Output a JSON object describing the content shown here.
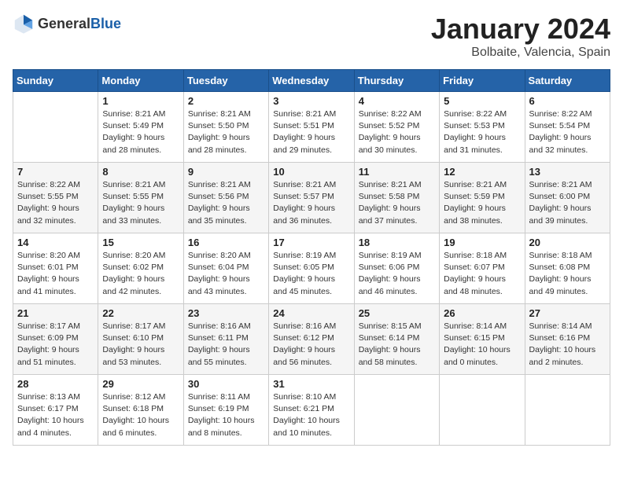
{
  "header": {
    "logo_general": "General",
    "logo_blue": "Blue",
    "title": "January 2024",
    "location": "Bolbaite, Valencia, Spain"
  },
  "weekdays": [
    "Sunday",
    "Monday",
    "Tuesday",
    "Wednesday",
    "Thursday",
    "Friday",
    "Saturday"
  ],
  "weeks": [
    [
      {
        "day": "",
        "info": ""
      },
      {
        "day": "1",
        "info": "Sunrise: 8:21 AM\nSunset: 5:49 PM\nDaylight: 9 hours\nand 28 minutes."
      },
      {
        "day": "2",
        "info": "Sunrise: 8:21 AM\nSunset: 5:50 PM\nDaylight: 9 hours\nand 28 minutes."
      },
      {
        "day": "3",
        "info": "Sunrise: 8:21 AM\nSunset: 5:51 PM\nDaylight: 9 hours\nand 29 minutes."
      },
      {
        "day": "4",
        "info": "Sunrise: 8:22 AM\nSunset: 5:52 PM\nDaylight: 9 hours\nand 30 minutes."
      },
      {
        "day": "5",
        "info": "Sunrise: 8:22 AM\nSunset: 5:53 PM\nDaylight: 9 hours\nand 31 minutes."
      },
      {
        "day": "6",
        "info": "Sunrise: 8:22 AM\nSunset: 5:54 PM\nDaylight: 9 hours\nand 32 minutes."
      }
    ],
    [
      {
        "day": "7",
        "info": "Sunrise: 8:22 AM\nSunset: 5:55 PM\nDaylight: 9 hours\nand 32 minutes."
      },
      {
        "day": "8",
        "info": "Sunrise: 8:21 AM\nSunset: 5:55 PM\nDaylight: 9 hours\nand 33 minutes."
      },
      {
        "day": "9",
        "info": "Sunrise: 8:21 AM\nSunset: 5:56 PM\nDaylight: 9 hours\nand 35 minutes."
      },
      {
        "day": "10",
        "info": "Sunrise: 8:21 AM\nSunset: 5:57 PM\nDaylight: 9 hours\nand 36 minutes."
      },
      {
        "day": "11",
        "info": "Sunrise: 8:21 AM\nSunset: 5:58 PM\nDaylight: 9 hours\nand 37 minutes."
      },
      {
        "day": "12",
        "info": "Sunrise: 8:21 AM\nSunset: 5:59 PM\nDaylight: 9 hours\nand 38 minutes."
      },
      {
        "day": "13",
        "info": "Sunrise: 8:21 AM\nSunset: 6:00 PM\nDaylight: 9 hours\nand 39 minutes."
      }
    ],
    [
      {
        "day": "14",
        "info": "Sunrise: 8:20 AM\nSunset: 6:01 PM\nDaylight: 9 hours\nand 41 minutes."
      },
      {
        "day": "15",
        "info": "Sunrise: 8:20 AM\nSunset: 6:02 PM\nDaylight: 9 hours\nand 42 minutes."
      },
      {
        "day": "16",
        "info": "Sunrise: 8:20 AM\nSunset: 6:04 PM\nDaylight: 9 hours\nand 43 minutes."
      },
      {
        "day": "17",
        "info": "Sunrise: 8:19 AM\nSunset: 6:05 PM\nDaylight: 9 hours\nand 45 minutes."
      },
      {
        "day": "18",
        "info": "Sunrise: 8:19 AM\nSunset: 6:06 PM\nDaylight: 9 hours\nand 46 minutes."
      },
      {
        "day": "19",
        "info": "Sunrise: 8:18 AM\nSunset: 6:07 PM\nDaylight: 9 hours\nand 48 minutes."
      },
      {
        "day": "20",
        "info": "Sunrise: 8:18 AM\nSunset: 6:08 PM\nDaylight: 9 hours\nand 49 minutes."
      }
    ],
    [
      {
        "day": "21",
        "info": "Sunrise: 8:17 AM\nSunset: 6:09 PM\nDaylight: 9 hours\nand 51 minutes."
      },
      {
        "day": "22",
        "info": "Sunrise: 8:17 AM\nSunset: 6:10 PM\nDaylight: 9 hours\nand 53 minutes."
      },
      {
        "day": "23",
        "info": "Sunrise: 8:16 AM\nSunset: 6:11 PM\nDaylight: 9 hours\nand 55 minutes."
      },
      {
        "day": "24",
        "info": "Sunrise: 8:16 AM\nSunset: 6:12 PM\nDaylight: 9 hours\nand 56 minutes."
      },
      {
        "day": "25",
        "info": "Sunrise: 8:15 AM\nSunset: 6:14 PM\nDaylight: 9 hours\nand 58 minutes."
      },
      {
        "day": "26",
        "info": "Sunrise: 8:14 AM\nSunset: 6:15 PM\nDaylight: 10 hours\nand 0 minutes."
      },
      {
        "day": "27",
        "info": "Sunrise: 8:14 AM\nSunset: 6:16 PM\nDaylight: 10 hours\nand 2 minutes."
      }
    ],
    [
      {
        "day": "28",
        "info": "Sunrise: 8:13 AM\nSunset: 6:17 PM\nDaylight: 10 hours\nand 4 minutes."
      },
      {
        "day": "29",
        "info": "Sunrise: 8:12 AM\nSunset: 6:18 PM\nDaylight: 10 hours\nand 6 minutes."
      },
      {
        "day": "30",
        "info": "Sunrise: 8:11 AM\nSunset: 6:19 PM\nDaylight: 10 hours\nand 8 minutes."
      },
      {
        "day": "31",
        "info": "Sunrise: 8:10 AM\nSunset: 6:21 PM\nDaylight: 10 hours\nand 10 minutes."
      },
      {
        "day": "",
        "info": ""
      },
      {
        "day": "",
        "info": ""
      },
      {
        "day": "",
        "info": ""
      }
    ]
  ]
}
